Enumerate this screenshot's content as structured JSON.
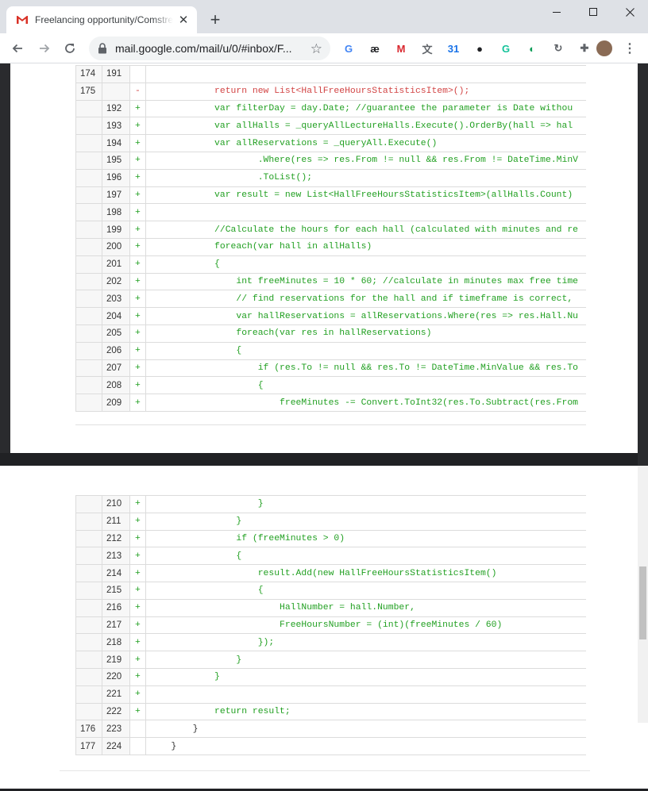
{
  "browser": {
    "tab_title": "Freelancing opportunity/Comstre",
    "url": "mail.google.com/mail/u/0/#inbox/F...",
    "new_tab_label": "+"
  },
  "extensions": [
    {
      "name": "google-translate-icon",
      "glyph": "G",
      "color": "#4285f4"
    },
    {
      "name": "ae-icon",
      "glyph": "æ",
      "color": "#202124"
    },
    {
      "name": "mega-icon",
      "glyph": "M",
      "color": "#d9272e"
    },
    {
      "name": "translate-icon",
      "glyph": "文",
      "color": "#5f6368"
    },
    {
      "name": "calendar-icon",
      "glyph": "31",
      "color": "#1a73e8"
    },
    {
      "name": "dark-ext-icon",
      "glyph": "●",
      "color": "#202124"
    },
    {
      "name": "grammarly-icon",
      "glyph": "G",
      "color": "#15c39a"
    },
    {
      "name": "edge-ext-icon",
      "glyph": "◐",
      "color": "#0f9d58"
    },
    {
      "name": "refresh-ext-icon",
      "glyph": "↻",
      "color": "#5f6368"
    },
    {
      "name": "puzzle-icon",
      "glyph": "✚",
      "color": "#5f6368"
    }
  ],
  "diff_top": [
    {
      "old": "174",
      "new": "191",
      "marker": "",
      "code": "",
      "type": "ctx"
    },
    {
      "old": "175",
      "new": "",
      "marker": "-",
      "code": "            return new List<HallFreeHoursStatisticsItem>();",
      "type": "del"
    },
    {
      "old": "",
      "new": "192",
      "marker": "+",
      "code": "            var filterDay = day.Date; //guarantee the parameter is Date withou",
      "type": "add"
    },
    {
      "old": "",
      "new": "193",
      "marker": "+",
      "code": "            var allHalls = _queryAllLectureHalls.Execute().OrderBy(hall => hal",
      "type": "add"
    },
    {
      "old": "",
      "new": "194",
      "marker": "+",
      "code": "            var allReservations = _queryAll.Execute()",
      "type": "add"
    },
    {
      "old": "",
      "new": "195",
      "marker": "+",
      "code": "                    .Where(res => res.From != null && res.From != DateTime.MinV",
      "type": "add"
    },
    {
      "old": "",
      "new": "196",
      "marker": "+",
      "code": "                    .ToList();",
      "type": "add"
    },
    {
      "old": "",
      "new": "197",
      "marker": "+",
      "code": "            var result = new List<HallFreeHoursStatisticsItem>(allHalls.Count)",
      "type": "add"
    },
    {
      "old": "",
      "new": "198",
      "marker": "+",
      "code": "",
      "type": "add"
    },
    {
      "old": "",
      "new": "199",
      "marker": "+",
      "code": "            //Calculate the hours for each hall (calculated with minutes and re",
      "type": "add"
    },
    {
      "old": "",
      "new": "200",
      "marker": "+",
      "code": "            foreach(var hall in allHalls)",
      "type": "add"
    },
    {
      "old": "",
      "new": "201",
      "marker": "+",
      "code": "            {",
      "type": "add"
    },
    {
      "old": "",
      "new": "202",
      "marker": "+",
      "code": "                int freeMinutes = 10 * 60; //calculate in minutes max free time",
      "type": "add"
    },
    {
      "old": "",
      "new": "203",
      "marker": "+",
      "code": "                // find reservations for the hall and if timeframe is correct,",
      "type": "add"
    },
    {
      "old": "",
      "new": "204",
      "marker": "+",
      "code": "                var hallReservations = allReservations.Where(res => res.Hall.Nu",
      "type": "add"
    },
    {
      "old": "",
      "new": "205",
      "marker": "+",
      "code": "                foreach(var res in hallReservations)",
      "type": "add"
    },
    {
      "old": "",
      "new": "206",
      "marker": "+",
      "code": "                {",
      "type": "add"
    },
    {
      "old": "",
      "new": "207",
      "marker": "+",
      "code": "                    if (res.To != null && res.To != DateTime.MinValue && res.To",
      "type": "add"
    },
    {
      "old": "",
      "new": "208",
      "marker": "+",
      "code": "                    {",
      "type": "add"
    },
    {
      "old": "",
      "new": "209",
      "marker": "+",
      "code": "                        freeMinutes -= Convert.ToInt32(res.To.Subtract(res.From",
      "type": "add"
    }
  ],
  "diff_bottom": [
    {
      "old": "",
      "new": "210",
      "marker": "+",
      "code": "                    }",
      "type": "add"
    },
    {
      "old": "",
      "new": "211",
      "marker": "+",
      "code": "                }",
      "type": "add"
    },
    {
      "old": "",
      "new": "212",
      "marker": "+",
      "code": "                if (freeMinutes > 0)",
      "type": "add"
    },
    {
      "old": "",
      "new": "213",
      "marker": "+",
      "code": "                {",
      "type": "add"
    },
    {
      "old": "",
      "new": "214",
      "marker": "+",
      "code": "                    result.Add(new HallFreeHoursStatisticsItem()",
      "type": "add"
    },
    {
      "old": "",
      "new": "215",
      "marker": "+",
      "code": "                    {",
      "type": "add"
    },
    {
      "old": "",
      "new": "216",
      "marker": "+",
      "code": "                        HallNumber = hall.Number,",
      "type": "add"
    },
    {
      "old": "",
      "new": "217",
      "marker": "+",
      "code": "                        FreeHoursNumber = (int)(freeMinutes / 60)",
      "type": "add"
    },
    {
      "old": "",
      "new": "218",
      "marker": "+",
      "code": "                    });",
      "type": "add"
    },
    {
      "old": "",
      "new": "219",
      "marker": "+",
      "code": "                }",
      "type": "add"
    },
    {
      "old": "",
      "new": "220",
      "marker": "+",
      "code": "            }",
      "type": "add"
    },
    {
      "old": "",
      "new": "221",
      "marker": "+",
      "code": "",
      "type": "add"
    },
    {
      "old": "",
      "new": "222",
      "marker": "+",
      "code": "            return result;",
      "type": "add"
    },
    {
      "old": "176",
      "new": "223",
      "marker": "",
      "code": "        }",
      "type": "ctx"
    },
    {
      "old": "177",
      "new": "224",
      "marker": "",
      "code": "    }",
      "type": "ctx"
    }
  ]
}
